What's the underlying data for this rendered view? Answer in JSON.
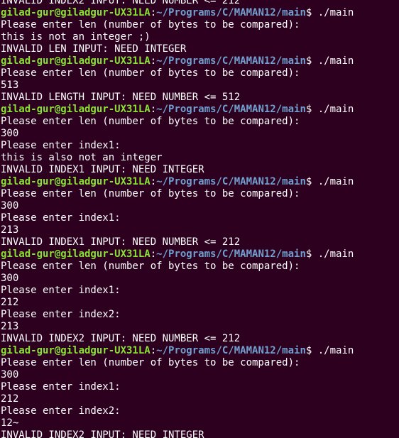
{
  "terminal": {
    "colors": {
      "background": "#2c001e",
      "text": "#ffffff",
      "user_host": "#8ae234",
      "path": "#729fcf"
    },
    "top_partial_line": "INVALID INDEX2 INPUT: NEED NUMBER <= 212",
    "sessions": [
      {
        "prompt": {
          "user_host": "gilad-gur@giladgur-UX31LA",
          "sep": ":",
          "path": "~/Programs/C/MAMAN12/main",
          "symbol": "$ ",
          "command": "./main"
        },
        "output": [
          "Please enter len (number of bytes to be compared):",
          "this is not an integer ;)",
          "INVALID LEN INPUT: NEED INTEGER"
        ]
      },
      {
        "prompt": {
          "user_host": "gilad-gur@giladgur-UX31LA",
          "sep": ":",
          "path": "~/Programs/C/MAMAN12/main",
          "symbol": "$ ",
          "command": "./main"
        },
        "output": [
          "Please enter len (number of bytes to be compared):",
          "513",
          "INVALID LENGTH INPUT: NEED NUMBER <= 512"
        ]
      },
      {
        "prompt": {
          "user_host": "gilad-gur@giladgur-UX31LA",
          "sep": ":",
          "path": "~/Programs/C/MAMAN12/main",
          "symbol": "$ ",
          "command": "./main"
        },
        "output": [
          "Please enter len (number of bytes to be compared):",
          "300",
          "Please enter index1:",
          "this is also not an integer",
          "INVALID INDEX1 INPUT: NEED INTEGER"
        ]
      },
      {
        "prompt": {
          "user_host": "gilad-gur@giladgur-UX31LA",
          "sep": ":",
          "path": "~/Programs/C/MAMAN12/main",
          "symbol": "$ ",
          "command": "./main"
        },
        "output": [
          "Please enter len (number of bytes to be compared):",
          "300",
          "Please enter index1:",
          "213",
          "INVALID INDEX1 INPUT: NEED NUMBER <= 212"
        ]
      },
      {
        "prompt": {
          "user_host": "gilad-gur@giladgur-UX31LA",
          "sep": ":",
          "path": "~/Programs/C/MAMAN12/main",
          "symbol": "$ ",
          "command": "./main"
        },
        "output": [
          "Please enter len (number of bytes to be compared):",
          "300",
          "Please enter index1:",
          "212",
          "Please enter index2:",
          "213",
          "INVALID INDEX2 INPUT: NEED NUMBER <= 212"
        ]
      },
      {
        "prompt": {
          "user_host": "gilad-gur@giladgur-UX31LA",
          "sep": ":",
          "path": "~/Programs/C/MAMAN12/main",
          "symbol": "$ ",
          "command": "./main"
        },
        "output": [
          "Please enter len (number of bytes to be compared):",
          "300",
          "Please enter index1:",
          "212",
          "Please enter index2:",
          "12~",
          "INVALID INDEX2 INPUT: NEED INTEGER"
        ]
      }
    ]
  }
}
